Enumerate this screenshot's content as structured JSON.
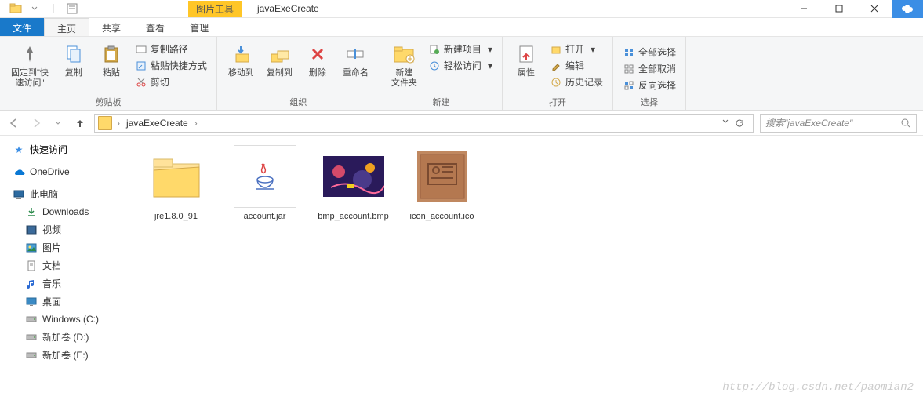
{
  "titlebar": {
    "context_tab": "图片工具",
    "window_title": "javaExeCreate"
  },
  "tabs": {
    "file": "文件",
    "home": "主页",
    "share": "共享",
    "view": "查看",
    "manage": "管理"
  },
  "ribbon": {
    "pin": {
      "label": "固定到\"快\n速访问\""
    },
    "copy": {
      "label": "复制"
    },
    "paste": {
      "label": "粘贴"
    },
    "copy_path": "复制路径",
    "paste_shortcut": "粘贴快捷方式",
    "cut": "剪切",
    "clipboard_group": "剪贴板",
    "move_to": "移动到",
    "copy_to": "复制到",
    "delete": "删除",
    "rename": "重命名",
    "organize_group": "组织",
    "new_folder": "新建\n文件夹",
    "new_item": "新建项目",
    "easy_access": "轻松访问",
    "new_group": "新建",
    "properties": "属性",
    "open": "打开",
    "edit": "编辑",
    "history": "历史记录",
    "open_group": "打开",
    "select_all": "全部选择",
    "select_none": "全部取消",
    "invert_sel": "反向选择",
    "select_group": "选择"
  },
  "addressbar": {
    "path": "javaExeCreate",
    "search_placeholder": "搜索\"javaExeCreate\""
  },
  "navpane": {
    "quick_access": "快速访问",
    "onedrive": "OneDrive",
    "this_pc": "此电脑",
    "downloads": "Downloads",
    "videos": "视频",
    "pictures": "图片",
    "documents": "文档",
    "music": "音乐",
    "desktop": "桌面",
    "windows_c": "Windows (C:)",
    "drive_d": "新加卷 (D:)",
    "drive_e": "新加卷 (E:)"
  },
  "files": [
    {
      "name": "jre1.8.0_91",
      "type": "folder"
    },
    {
      "name": "account.jar",
      "type": "jar"
    },
    {
      "name": "bmp_account.bmp",
      "type": "bmp"
    },
    {
      "name": "icon_account.ico",
      "type": "ico"
    }
  ],
  "watermark": "http://blog.csdn.net/paomian2"
}
